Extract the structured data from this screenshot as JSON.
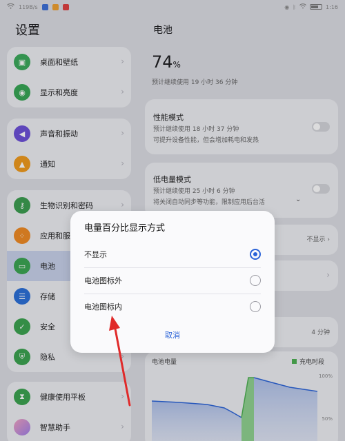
{
  "status_bar": {
    "speed": "119B/s",
    "time": "1:16"
  },
  "settings": {
    "title": "设置",
    "groups": [
      {
        "items": [
          {
            "label": "桌面和壁纸",
            "icon": "wallpaper-icon",
            "color": "#3aaa5a"
          },
          {
            "label": "显示和亮度",
            "icon": "eye-icon",
            "color": "#36a653"
          }
        ]
      },
      {
        "items": [
          {
            "label": "声音和振动",
            "icon": "speaker-icon",
            "color": "#6c4fd8"
          },
          {
            "label": "通知",
            "icon": "bell-icon",
            "color": "#f09b1c"
          }
        ]
      },
      {
        "items": [
          {
            "label": "生物识别和密码",
            "icon": "key-icon",
            "color": "#3a9d4e"
          },
          {
            "label": "应用和服务",
            "icon": "apps-icon",
            "color": "#f08a22"
          },
          {
            "label": "电池",
            "icon": "battery-icon",
            "color": "#3aa551",
            "active": true
          },
          {
            "label": "存储",
            "icon": "storage-icon",
            "color": "#2a6fd8"
          },
          {
            "label": "安全",
            "icon": "shield-icon",
            "color": "#3aa34e"
          },
          {
            "label": "隐私",
            "icon": "privacy-icon",
            "color": "#3aa34e"
          }
        ]
      },
      {
        "items": [
          {
            "label": "健康使用平板",
            "icon": "hourglass-icon",
            "color": "#3aa34e"
          },
          {
            "label": "智慧助手",
            "icon": "assistant-icon",
            "color": "#d58ae0"
          }
        ]
      }
    ]
  },
  "battery": {
    "title": "电池",
    "percent": "74",
    "percent_unit": "%",
    "remaining": "预计继续使用 19 小时 36 分钟",
    "performance_mode": {
      "title": "性能模式",
      "estimate": "预计继续使用 18 小时 37 分钟",
      "desc": "可提升设备性能，但会增加耗电和发热"
    },
    "low_power_mode": {
      "title": "低电量模式",
      "estimate": "预计继续使用 25 小时 6 分钟",
      "desc": "将关闭自动同步等功能，限制应用后台活"
    },
    "percent_display_value": "不显示",
    "usage_value": "4 分钟",
    "chart_title": "电池电量",
    "chart_legend": "充电时段",
    "chart_y_top": "100%",
    "chart_y_mid": "50%"
  },
  "dialog": {
    "title": "电量百分比显示方式",
    "options": [
      {
        "label": "不显示",
        "selected": true
      },
      {
        "label": "电池图标外",
        "selected": false
      },
      {
        "label": "电池图标内",
        "selected": false
      }
    ],
    "cancel": "取消"
  },
  "colors": {
    "accent": "#2a63d8",
    "charging": "#4caf50",
    "chart_line": "#2a63d8"
  }
}
